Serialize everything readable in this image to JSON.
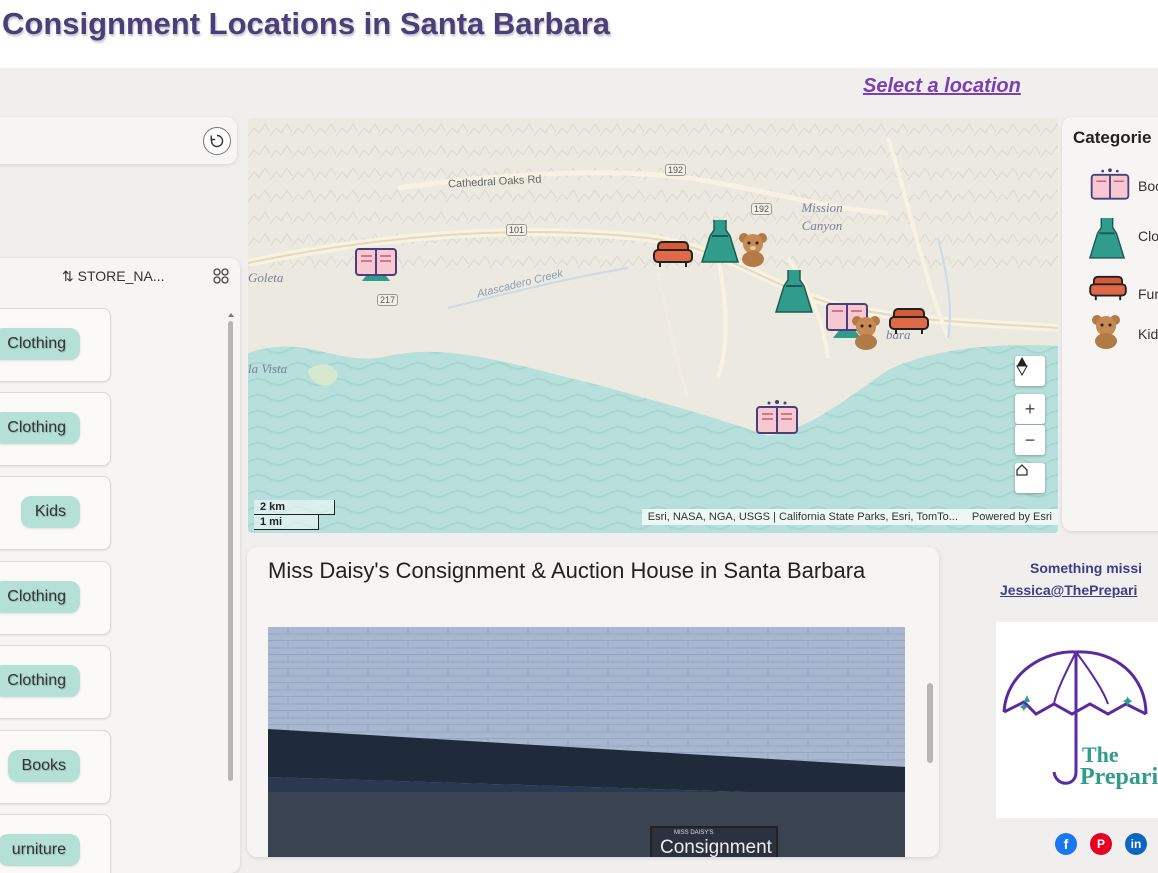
{
  "header": {
    "title": "Consignment Locations in Santa Barbara"
  },
  "select_location": {
    "label": "Select a location"
  },
  "list": {
    "sort_label": "⇅ STORE_NA...",
    "items": [
      {
        "category": "Clothing"
      },
      {
        "category": "Clothing"
      },
      {
        "category": "Kids"
      },
      {
        "category": "Clothing"
      },
      {
        "category": "Clothing"
      },
      {
        "category": "Books"
      },
      {
        "category": "urniture"
      }
    ]
  },
  "map": {
    "place_labels": {
      "cathedral_oaks": "Cathedral Oaks Rd",
      "mission_canyon": "Mission Canyon",
      "goleta": "Goleta",
      "isla_vista": "la Vista",
      "atascadero_creek": "Atascadero Creek",
      "santa_barbara": "bara",
      "route_192_a": "192",
      "route_192_b": "192",
      "route_101": "101",
      "route_217": "217"
    },
    "markers": [
      {
        "category": "Books",
        "icon": "book-icon"
      },
      {
        "category": "Furniture",
        "icon": "sofa-icon"
      },
      {
        "category": "Clothing",
        "icon": "dress-icon"
      },
      {
        "category": "Kids",
        "icon": "teddy-bear-icon"
      },
      {
        "category": "Clothing",
        "icon": "dress-icon"
      },
      {
        "category": "Books",
        "icon": "book-icon"
      },
      {
        "category": "Kids",
        "icon": "teddy-bear-icon"
      },
      {
        "category": "Furniture",
        "icon": "sofa-icon"
      },
      {
        "category": "Books",
        "icon": "book-icon"
      }
    ],
    "controls": {
      "zoom_in": "+",
      "zoom_out": "−"
    },
    "scale": {
      "km": "2 km",
      "mi": "1 mi"
    },
    "attribution": "Esri, NASA, NGA, USGS | California State Parks, Esri, TomTo...",
    "powered_by": "Powered by Esri"
  },
  "legend": {
    "title": "Categorie",
    "items": [
      {
        "label": "Boo",
        "icon": "book-icon"
      },
      {
        "label": "Clo",
        "icon": "dress-icon"
      },
      {
        "label": "Fur",
        "icon": "sofa-icon"
      },
      {
        "label": "Kid",
        "icon": "teddy-bear-icon"
      }
    ]
  },
  "detail": {
    "title": "Miss Daisy's Consignment & Auction House in Santa Barbara",
    "sign_small": "MISS DAISY'S",
    "sign_large": "Consignment"
  },
  "contact": {
    "missing_text": "Something missi",
    "email": "Jessica@ThePrepari"
  },
  "logo": {
    "line1": "The",
    "line2": "Prepari"
  },
  "social": {
    "facebook": "f",
    "pinterest": "P",
    "linkedin": "in"
  },
  "colors": {
    "title": "#4a3f7a",
    "link": "#7b3fb0",
    "tag": "#b5e0d6",
    "water": "#b7e0dc",
    "land": "#ece9e0",
    "dress": "#2f9c8c",
    "sofa": "#d45a38",
    "book": "#e78a9e",
    "bear": "#b27a45"
  }
}
